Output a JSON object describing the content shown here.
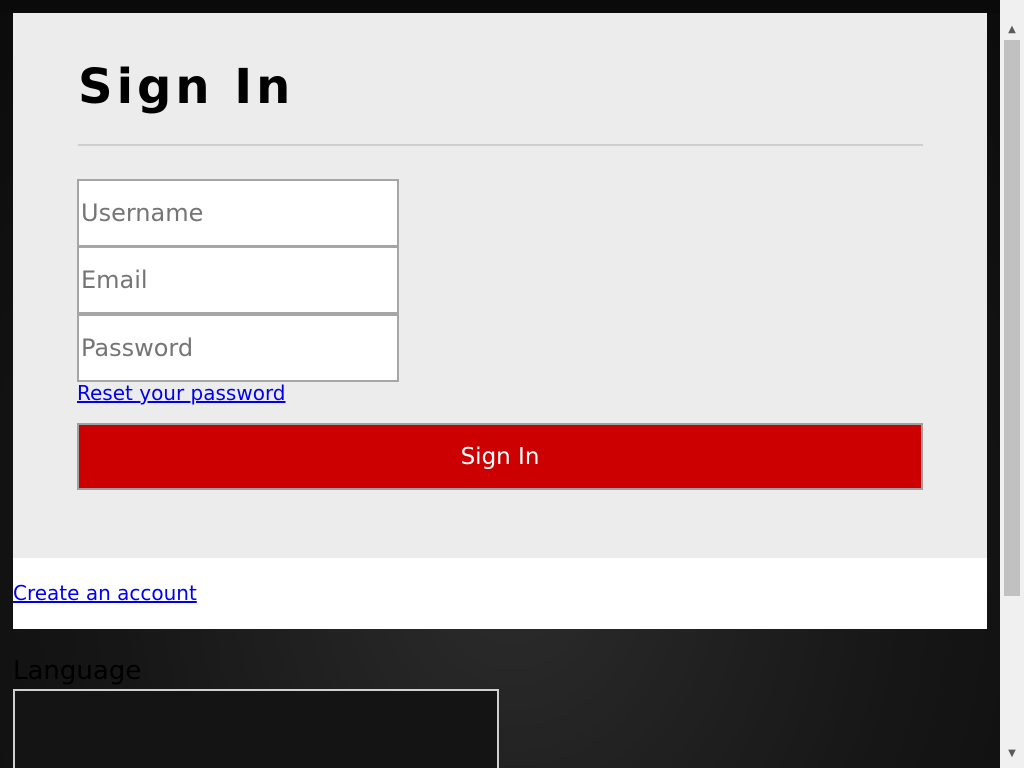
{
  "signin": {
    "title": "Sign In",
    "username_placeholder": "Username",
    "email_placeholder": "Email",
    "password_placeholder": "Password",
    "reset_link": "Reset your password",
    "submit_label": "Sign In"
  },
  "footer": {
    "create_account_link": "Create an account"
  },
  "language": {
    "label": "Language"
  },
  "colors": {
    "accent": "#cc0000",
    "panel": "#ececec",
    "link": "#0000ee",
    "backdrop": "#161616"
  },
  "icons": {
    "scroll_up": "triangle-up-icon",
    "scroll_down": "triangle-down-icon"
  }
}
